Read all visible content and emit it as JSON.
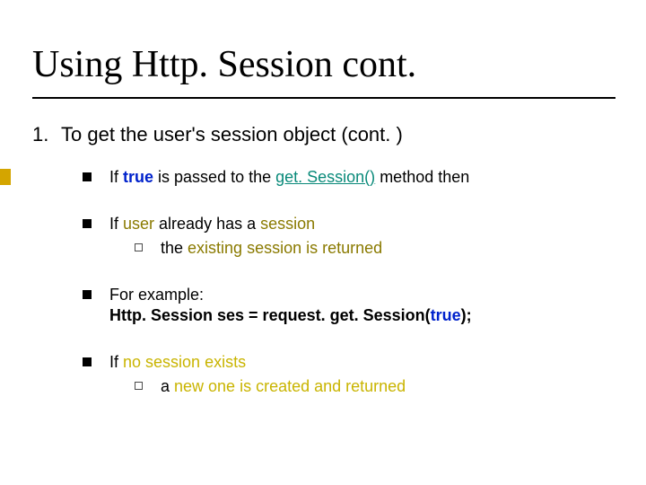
{
  "title": "Using Http. Session cont.",
  "list": {
    "number": "1.",
    "text_a": "To get the user's session object (cont. )"
  },
  "b1": {
    "a": "If ",
    "true": "true",
    "b": " is passed to the ",
    "method": "get. Session()",
    "c": " method then"
  },
  "b2": {
    "a": "If ",
    "user": "user",
    "b": " already has a ",
    "session": "session",
    "sub_a": " the ",
    "sub_ex": "existing session is returned"
  },
  "b3": {
    "a": "For example:",
    "code_a": "Http. Session ses = request. get. Session(",
    "code_true": "true",
    "code_b": ");"
  },
  "b4": {
    "a": "If ",
    "nosession": "no session exists",
    "sub_a": " a ",
    "sub_new": "new one is created and returned"
  }
}
